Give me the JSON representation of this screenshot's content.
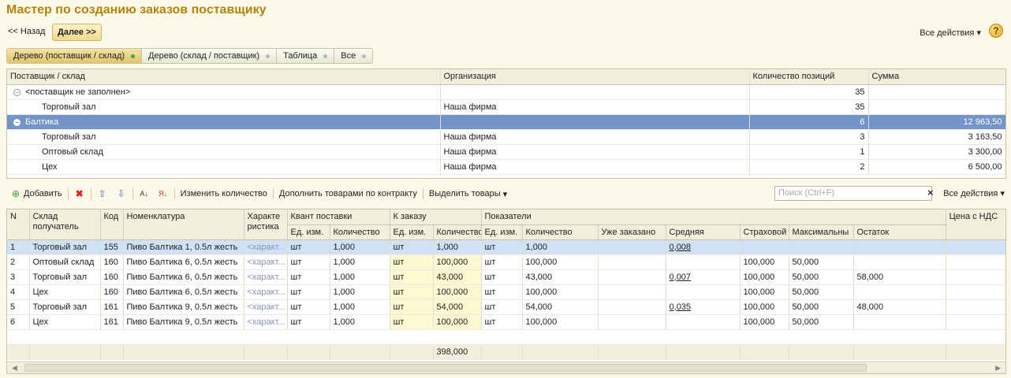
{
  "window": {
    "title": "Мастер по созданию заказов поставщику"
  },
  "nav": {
    "back_label": "<< Назад",
    "next_label": "Далее >>",
    "all_actions": "Все действия",
    "help": "?"
  },
  "view_tabs": [
    {
      "label": "Дерево (поставщик / склад)",
      "active": true
    },
    {
      "label": "Дерево (склад / поставщик)",
      "active": false
    },
    {
      "label": "Таблица",
      "active": false
    },
    {
      "label": "Все",
      "active": false
    }
  ],
  "tree_table": {
    "columns": [
      "Поставщик / склад",
      "Организация",
      "Количество позиций",
      "Сумма"
    ],
    "rows": [
      {
        "name": "<поставщик не заполнен>",
        "org": "",
        "count": "35",
        "sum": ""
      },
      {
        "name": "Торговый зал",
        "org": "Наша фирма",
        "count": "35",
        "sum": ""
      },
      {
        "name": "Балтика",
        "org": "",
        "count": "6",
        "sum": "12 963,50"
      },
      {
        "name": "Торговый зал",
        "org": "Наша фирма",
        "count": "3",
        "sum": "3 163,50"
      },
      {
        "name": "Оптовый склад",
        "org": "Наша фирма",
        "count": "1",
        "sum": "3 300,00"
      },
      {
        "name": "Цех",
        "org": "Наша фирма",
        "count": "2",
        "sum": "6 500,00"
      }
    ]
  },
  "toolbar": {
    "add": "Добавить",
    "change_qty": "Изменить количество",
    "fill_by_contract": "Дополнить товарами по контракту",
    "select_goods": "Выделить товары",
    "search_placeholder": "Поиск (Ctrl+F)",
    "all_actions": "Все действия"
  },
  "goods_table": {
    "headers": {
      "n": "N",
      "warehouse": "Склад получатель",
      "code": "Код",
      "nomenclature": "Номенклатура",
      "characteristic": "Характе ристика",
      "quant": "Квант поставки",
      "to_order": "К заказу",
      "indicators": "Показатели",
      "price_vat": "Цена с НДС",
      "unit": "Ед. изм.",
      "qty": "Количество",
      "already": "Уже заказано",
      "avg": "Средняя",
      "safety": "Страховой",
      "max": "Максимальны",
      "rest": "Остаток"
    },
    "rows": [
      {
        "n": "1",
        "wh": "Торговый зал",
        "code": "155",
        "nom": "Пиво Балтика 1, 0.5л жесть",
        "char": "<характ...",
        "qu": "шт",
        "qq": "1,000",
        "ou": "шт",
        "oq": "1,000",
        "pu": "шт",
        "pq": "1,000",
        "already": "",
        "avg": "0,008",
        "safety": "",
        "max": "",
        "rest": "",
        "price": ""
      },
      {
        "n": "2",
        "wh": "Оптовый склад",
        "code": "160",
        "nom": "Пиво Балтика 6, 0.5л жесть",
        "char": "<характ...",
        "qu": "шт",
        "qq": "1,000",
        "ou": "шт",
        "oq": "100,000",
        "pu": "шт",
        "pq": "100,000",
        "already": "",
        "avg": "",
        "safety": "100,000",
        "max": "50,000",
        "rest": "",
        "price": ""
      },
      {
        "n": "3",
        "wh": "Торговый зал",
        "code": "160",
        "nom": "Пиво Балтика 6, 0.5л жесть",
        "char": "<характ...",
        "qu": "шт",
        "qq": "1,000",
        "ou": "шт",
        "oq": "43,000",
        "pu": "шт",
        "pq": "43,000",
        "already": "",
        "avg": "0,007",
        "safety": "100,000",
        "max": "50,000",
        "rest": "58,000",
        "price": ""
      },
      {
        "n": "4",
        "wh": "Цех",
        "code": "160",
        "nom": "Пиво Балтика 6, 0.5л жесть",
        "char": "<характ...",
        "qu": "шт",
        "qq": "1,000",
        "ou": "шт",
        "oq": "100,000",
        "pu": "шт",
        "pq": "100,000",
        "already": "",
        "avg": "",
        "safety": "100,000",
        "max": "50,000",
        "rest": "",
        "price": ""
      },
      {
        "n": "5",
        "wh": "Торговый зал",
        "code": "161",
        "nom": "Пиво Балтика 9, 0.5л жесть",
        "char": "<характ...",
        "qu": "шт",
        "qq": "1,000",
        "ou": "шт",
        "oq": "54,000",
        "pu": "шт",
        "pq": "54,000",
        "already": "",
        "avg": "0,035",
        "safety": "100,000",
        "max": "50,000",
        "rest": "48,000",
        "price": ""
      },
      {
        "n": "6",
        "wh": "Цех",
        "code": "161",
        "nom": "Пиво Балтика 9, 0.5л жесть",
        "char": "<характ...",
        "qu": "шт",
        "qq": "1,000",
        "ou": "шт",
        "oq": "100,000",
        "pu": "шт",
        "pq": "100,000",
        "already": "",
        "avg": "",
        "safety": "100,000",
        "max": "50,000",
        "rest": "",
        "price": ""
      }
    ],
    "total_to_order": "398,000"
  }
}
